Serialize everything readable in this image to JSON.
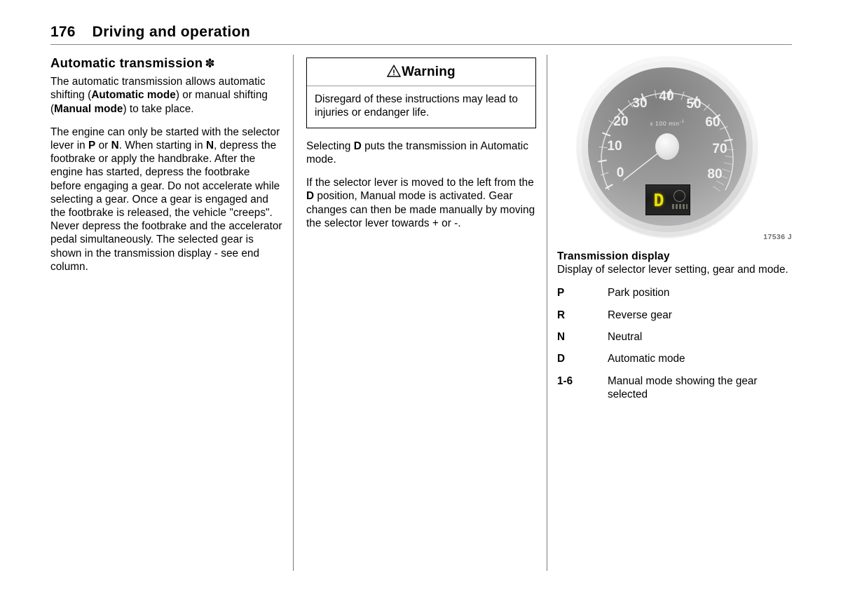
{
  "header": {
    "page_number": "176",
    "title": "Driving and operation"
  },
  "column_left": {
    "section_title": "Automatic transmission",
    "section_title_mark": "✽",
    "paragraph_1_html": "The automatic transmission allows automatic shifting (<b>Automatic mode</b>) or manual shifting (<b>Manual mode</b>) to take place.",
    "paragraph_2_html": "The engine can only be started with the selector lever in <b>P</b> or <b>N</b>. When starting in <b>N</b>, depress the footbrake or apply the handbrake. After the engine has started, depress the footbrake before engaging a gear. Do not accelerate while selecting a gear. Once a gear is engaged and the footbrake is released, the vehicle \"creeps\". Never depress the footbrake and the accelerator pedal simultaneously. The selected gear is shown in the transmission display - see end column."
  },
  "column_middle": {
    "warning": {
      "icon": "warning-triangle-icon",
      "label": "Warning",
      "text": "Disregard of these instructions may lead to injuries or endanger life."
    },
    "paragraph_1_html": "Selecting <b>D</b> puts the transmission in Automatic mode.",
    "paragraph_2_html": "If the selector lever is moved to the left from the <b>D</b> position, Manual mode is activated. Gear changes can then be made manually by moving the selector lever towards + or -."
  },
  "column_right": {
    "figure": {
      "caption": "17536 J",
      "gauge": {
        "unit_label": "x 100 min",
        "unit_exponent": "-1",
        "tick_labels": [
          "0",
          "10",
          "20",
          "30",
          "40",
          "50",
          "60",
          "70",
          "80"
        ],
        "needle_value": "0"
      },
      "display_readout": "D"
    },
    "sub_title": "Transmission display",
    "intro": "Display of selector lever setting, gear and mode.",
    "definitions": [
      {
        "term": "P",
        "desc": "Park position"
      },
      {
        "term": "R",
        "desc": "Reverse gear"
      },
      {
        "term": "N",
        "desc": "Neutral"
      },
      {
        "term": "D",
        "desc": "Automatic mode"
      },
      {
        "term": "1-6",
        "desc": "Manual mode showing the gear selected"
      }
    ]
  },
  "colors": {
    "text": "#000000",
    "rule": "#888888",
    "divider": "#7a7a7a",
    "display_yellow": "#e8e000",
    "caption_grey": "#6d6d6d"
  }
}
